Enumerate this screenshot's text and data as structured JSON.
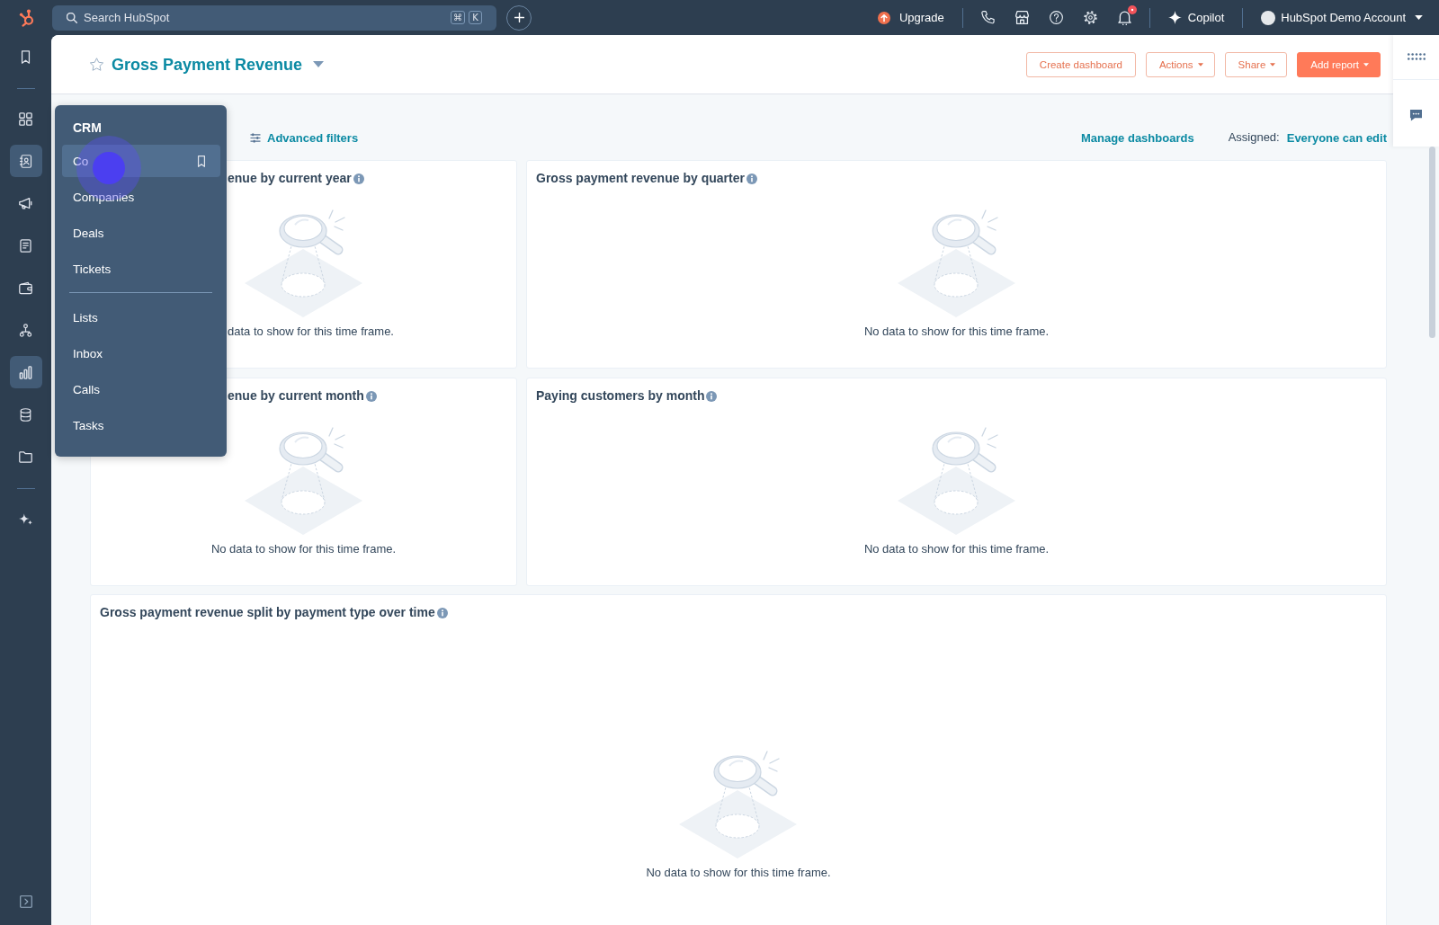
{
  "top_bar": {
    "search": {
      "placeholder": "Search HubSpot",
      "shortcut": [
        "⌘",
        "K"
      ]
    },
    "upgrade": "Upgrade",
    "notifications_unread": true,
    "copilot": "Copilot",
    "account": "HubSpot Demo Account"
  },
  "sidebar": {
    "sections": [
      {
        "items": [
          {
            "selected": false
          }
        ]
      },
      {
        "items": [
          {
            "selected": false
          },
          {
            "selected": true
          },
          {
            "selected": false
          },
          {
            "selected": false
          },
          {
            "selected": false
          },
          {
            "selected": false
          },
          {
            "selected": true
          },
          {
            "selected": false
          },
          {
            "selected": false
          }
        ]
      },
      {
        "items": [
          {
            "selected": false
          }
        ]
      }
    ]
  },
  "header": {
    "title": "Gross Payment Revenue",
    "starred": false,
    "buttons": [
      {
        "label": "Create dashboard",
        "kind": "outline",
        "dropdown": false
      },
      {
        "label": "Actions",
        "kind": "outline",
        "dropdown": true
      },
      {
        "label": "Share",
        "kind": "outline",
        "dropdown": true
      },
      {
        "label": "Add report",
        "kind": "primary",
        "dropdown": true
      }
    ]
  },
  "filters": {
    "advanced": "Advanced filters",
    "manage": "Manage dashboards",
    "assigned_label": "Assigned:",
    "assigned_value": "Everyone can edit"
  },
  "cards": [
    {
      "title": "enue by current year",
      "message": "data to show for this time frame."
    },
    {
      "title": "Gross payment revenue by quarter",
      "message": "No data to show for this time frame."
    },
    {
      "title": "enue by current month",
      "message": "No data to show for this time frame."
    },
    {
      "title": "Paying customers by month",
      "message": "No data to show for this time frame."
    },
    {
      "title": "Gross payment revenue split by payment type over time",
      "message": "No data to show for this time frame."
    }
  ],
  "crm_menu": {
    "open": true,
    "title": "CRM",
    "sections": [
      {
        "items": [
          {
            "label": "Co",
            "hovered": true
          },
          {
            "label": "Companies",
            "hovered": false
          },
          {
            "label": "Deals",
            "hovered": false
          },
          {
            "label": "Tickets",
            "hovered": false
          }
        ]
      },
      {
        "items": [
          {
            "label": "Lists",
            "hovered": false
          },
          {
            "label": "Inbox",
            "hovered": false
          },
          {
            "label": "Calls",
            "hovered": false
          },
          {
            "label": "Tasks",
            "hovered": false
          }
        ]
      }
    ]
  }
}
